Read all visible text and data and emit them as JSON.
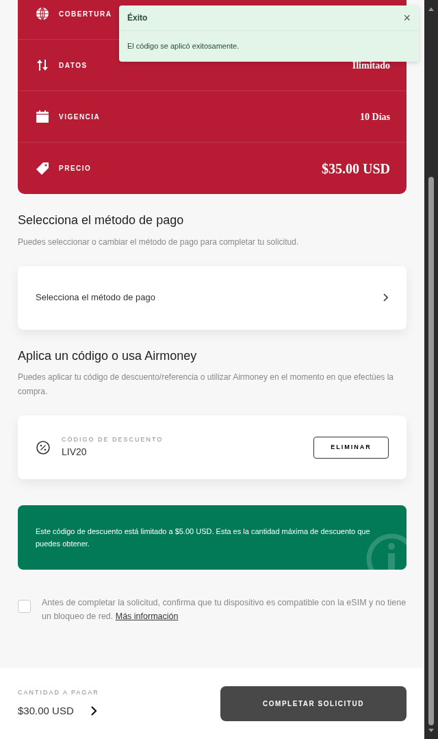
{
  "plan_details": [
    {
      "kind": "coverage",
      "label": "COBERTURA"
    },
    {
      "kind": "data",
      "label": "DATOS",
      "value": "Ilimitado"
    },
    {
      "kind": "validity",
      "label": "VIGENCIA",
      "value": "10 Días"
    },
    {
      "kind": "price",
      "label": "PRECIO",
      "value": "$35.00 USD"
    }
  ],
  "toast": {
    "title": "Éxito",
    "close": "×",
    "message": "El código se aplicó exitosamente."
  },
  "payment": {
    "heading": "Selecciona el método de pago",
    "description": "Puedes seleccionar o cambiar el método de pago para completar tu solicitud.",
    "selector_label": "Selecciona el método de pago"
  },
  "discount": {
    "heading": "Aplica un código o usa Airmoney",
    "description": "Puedes aplicar tu código de descuento/referencia o utilizar Airmoney en el momento en que efectúes la compra.",
    "code_label": "CÓDIGO DE DESCUENTO",
    "code_value": "LIV20",
    "remove_button": "ELIMINAR"
  },
  "info_alert": "Este código de descuento está limitado a $5.00 USD. Esta es la cantidad máxima de descuento que puedes obtener.",
  "agreement": {
    "checked": false,
    "text": "Antes de completar la solicitud, confirma que tu dispositivo es compatible con la eSIM y no tiene un bloqueo de red.",
    "link": "Más información"
  },
  "footer": {
    "amount_label": "CANTIDAD A PAGAR",
    "amount": "$30.00 USD",
    "submit_button": "COMPLETAR SOLICITUD"
  }
}
